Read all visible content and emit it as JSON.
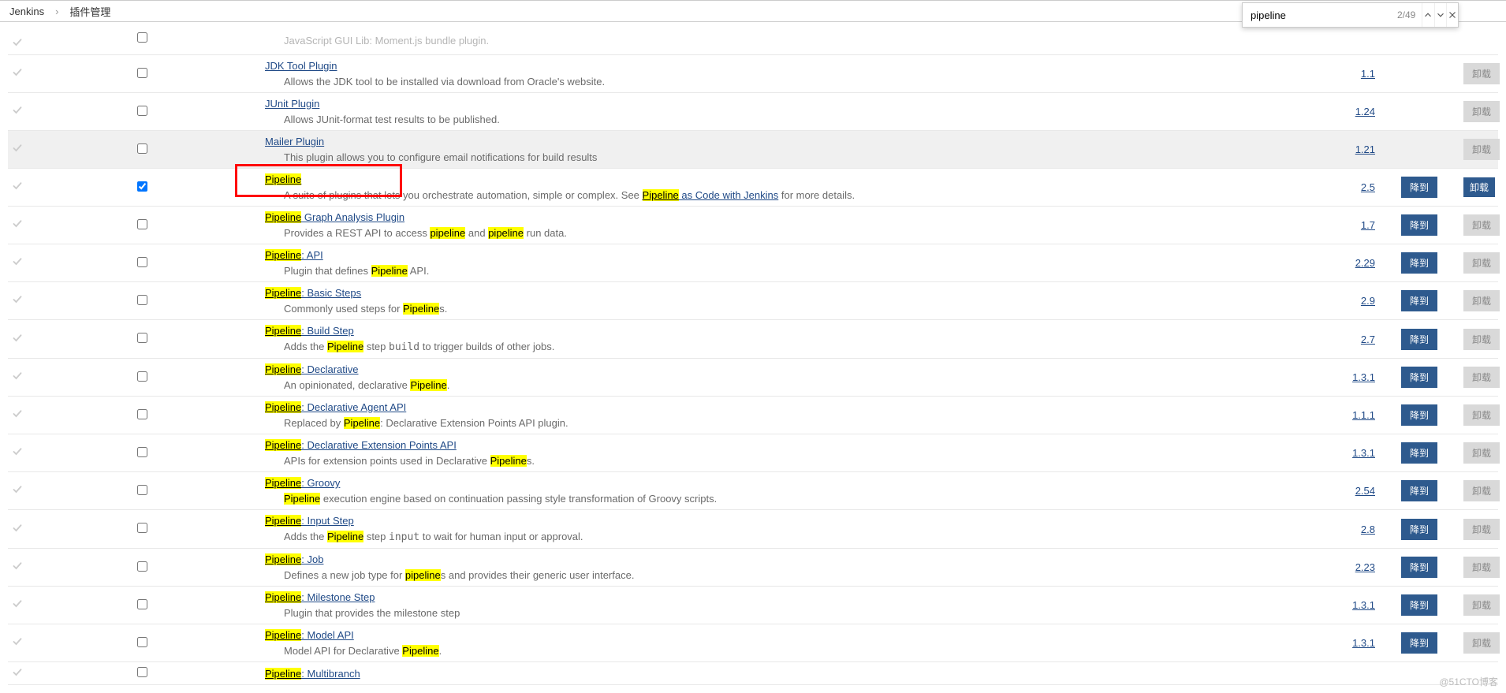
{
  "breadcrumb": {
    "root": "Jenkins",
    "current": "插件管理"
  },
  "findbar": {
    "query": "pipeline",
    "counter": "2/49"
  },
  "buttons": {
    "downgrade": "降到",
    "uninstall": "卸载"
  },
  "highlight_word": "Pipeline",
  "highlight_word_lc": "pipeline",
  "plugins": [
    {
      "enabled": true,
      "checked": false,
      "title_parts": [
        [
          "",
          ""
        ]
      ],
      "title_plain": "",
      "desc_html": "JavaScript GUI Lib: Moment.js bundle plugin.",
      "version": "",
      "downgrade": false,
      "uninstall": false,
      "hovered": false,
      "pad": true,
      "faded_desc": true
    },
    {
      "enabled": true,
      "checked": false,
      "title_plain": "JDK Tool Plugin",
      "desc_html": "Allows the JDK tool to be installed via download from Oracle's website.",
      "version": "1.1",
      "downgrade": false,
      "uninstall": true,
      "hovered": false
    },
    {
      "enabled": true,
      "checked": false,
      "title_plain": "JUnit Plugin",
      "desc_html": "Allows JUnit-format test results to be published.",
      "version": "1.24",
      "downgrade": false,
      "uninstall": true,
      "hovered": false
    },
    {
      "enabled": true,
      "checked": false,
      "title_plain": "Mailer Plugin",
      "desc_html": "This plugin allows you to configure email notifications for build results",
      "version": "1.21",
      "downgrade": false,
      "uninstall": true,
      "hovered": true
    },
    {
      "enabled": true,
      "checked": true,
      "title_hl": "Pipeline",
      "desc_pre": "A suite of plugins that lets you orchestrate automation, simple or complex. See ",
      "desc_link_hl": "Pipeline",
      "desc_link_rest": " as Code with Jenkins",
      "desc_post": " for more details.",
      "version": "2.5",
      "downgrade": true,
      "uninstall": false,
      "uninstall_dark": true,
      "hovered": false,
      "redbox": true
    },
    {
      "enabled": true,
      "checked": false,
      "title_hl": "Pipeline",
      "title_rest": " Graph Analysis Plugin",
      "desc_pre": "Provides a REST API to access ",
      "desc_hl1": "pipeline",
      "desc_mid": " and ",
      "desc_hl2": "pipeline",
      "desc_post": " run data.",
      "version": "1.7",
      "downgrade": true,
      "uninstall": true,
      "hovered": false
    },
    {
      "enabled": true,
      "checked": false,
      "title_hl": "Pipeline",
      "title_rest": ": API",
      "desc_pre": "Plugin that defines ",
      "desc_hl1": "Pipeline",
      "desc_post": " API.",
      "version": "2.29",
      "downgrade": true,
      "uninstall": true,
      "hovered": false
    },
    {
      "enabled": true,
      "checked": false,
      "title_hl": "Pipeline",
      "title_rest": ": Basic Steps",
      "desc_pre": "Commonly used steps for ",
      "desc_hl1": "Pipeline",
      "desc_post": "s.",
      "version": "2.9",
      "downgrade": true,
      "uninstall": true,
      "hovered": false
    },
    {
      "enabled": true,
      "checked": false,
      "title_hl": "Pipeline",
      "title_rest": ": Build Step",
      "desc_pre": "Adds the ",
      "desc_hl1": "Pipeline",
      "desc_mid": " step ",
      "desc_code": "build",
      "desc_post": " to trigger builds of other jobs.",
      "version": "2.7",
      "downgrade": true,
      "uninstall": true,
      "hovered": false
    },
    {
      "enabled": true,
      "checked": false,
      "title_hl": "Pipeline",
      "title_rest": ": Declarative",
      "desc_pre": "An opinionated, declarative ",
      "desc_hl1": "Pipeline",
      "desc_post": ".",
      "version": "1.3.1",
      "downgrade": true,
      "uninstall": true,
      "hovered": false
    },
    {
      "enabled": true,
      "checked": false,
      "title_hl": "Pipeline",
      "title_rest": ": Declarative Agent API",
      "desc_pre": "Replaced by ",
      "desc_hl1": "Pipeline",
      "desc_post": ": Declarative Extension Points API plugin.",
      "version": "1.1.1",
      "downgrade": true,
      "uninstall": true,
      "hovered": false
    },
    {
      "enabled": true,
      "checked": false,
      "title_hl": "Pipeline",
      "title_rest": ": Declarative Extension Points API",
      "desc_pre": "APIs for extension points used in Declarative ",
      "desc_hl1": "Pipeline",
      "desc_post": "s.",
      "version": "1.3.1",
      "downgrade": true,
      "uninstall": true,
      "hovered": false
    },
    {
      "enabled": true,
      "checked": false,
      "title_hl": "Pipeline",
      "title_rest": ": Groovy",
      "desc_hl_first": "Pipeline",
      "desc_post": " execution engine based on continuation passing style transformation of Groovy scripts.",
      "version": "2.54",
      "downgrade": true,
      "uninstall": true,
      "hovered": false
    },
    {
      "enabled": true,
      "checked": false,
      "title_hl": "Pipeline",
      "title_rest": ": Input Step",
      "desc_pre": "Adds the ",
      "desc_hl1": "Pipeline",
      "desc_mid": " step ",
      "desc_code": "input",
      "desc_post": " to wait for human input or approval.",
      "version": "2.8",
      "downgrade": true,
      "uninstall": true,
      "hovered": false
    },
    {
      "enabled": true,
      "checked": false,
      "title_hl": "Pipeline",
      "title_rest": ": Job",
      "desc_pre": "Defines a new job type for ",
      "desc_hl1": "pipeline",
      "desc_post": "s and provides their generic user interface.",
      "version": "2.23",
      "downgrade": true,
      "uninstall": true,
      "hovered": false
    },
    {
      "enabled": true,
      "checked": false,
      "title_hl": "Pipeline",
      "title_rest": ": Milestone Step",
      "desc_pre": "Plugin that provides the milestone step",
      "version": "1.3.1",
      "downgrade": true,
      "uninstall": true,
      "hovered": false
    },
    {
      "enabled": true,
      "checked": false,
      "title_hl": "Pipeline",
      "title_rest": ": Model API",
      "desc_pre": "Model API for Declarative ",
      "desc_hl1": "Pipeline",
      "desc_post": ".",
      "version": "1.3.1",
      "downgrade": true,
      "uninstall": true,
      "hovered": false
    },
    {
      "enabled": true,
      "checked": false,
      "title_hl": "Pipeline",
      "title_rest": ": Multibranch",
      "no_desc": true,
      "version": "",
      "downgrade": false,
      "uninstall": false,
      "hovered": false,
      "last": true
    }
  ],
  "watermark": "@51CTO博客"
}
